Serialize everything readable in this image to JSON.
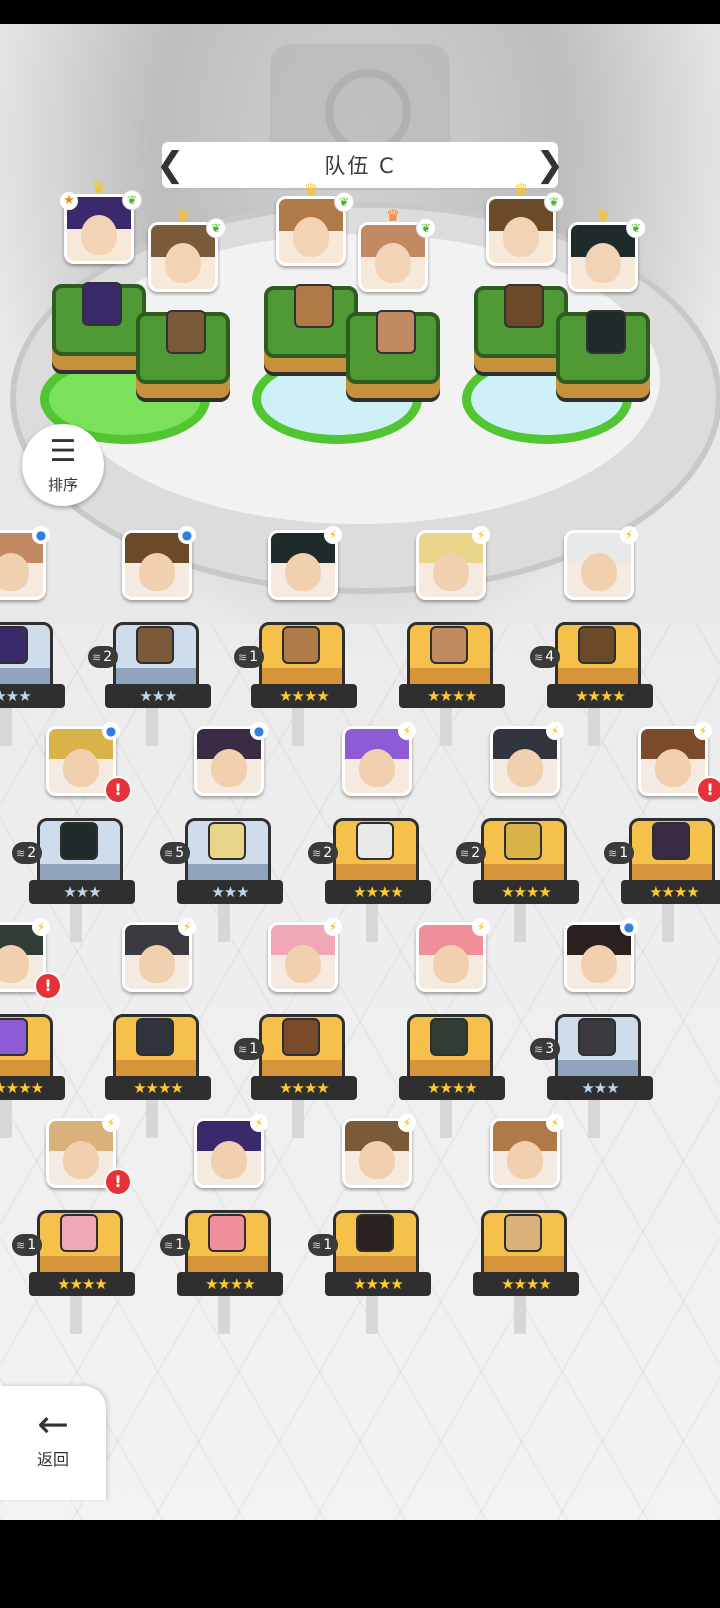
{
  "team": {
    "title": "队伍 C",
    "prev": "❮",
    "next": "❯"
  },
  "sort": {
    "label": "排序",
    "icon": "sort-icon"
  },
  "back": {
    "label": "返回",
    "icon": "back-arrow-icon"
  },
  "team_slots": [
    {
      "leader": "★",
      "type": "earth",
      "crown": "gold"
    },
    {
      "type": "earth",
      "crown": "gold"
    },
    {
      "type": "earth",
      "crown": "gold"
    },
    {
      "type": "earth",
      "crown": "orange"
    },
    {
      "type": "earth",
      "crown": "gold"
    },
    {
      "type": "earth",
      "crown": "gold"
    }
  ],
  "roster": [
    {
      "stars": "★★★",
      "tier": "blue",
      "type": "water",
      "count": ""
    },
    {
      "stars": "★★★",
      "tier": "blue",
      "type": "water",
      "count": "2"
    },
    {
      "stars": "★★★★",
      "tier": "gold",
      "type": "bolt",
      "count": "1"
    },
    {
      "stars": "★★★★",
      "tier": "gold",
      "type": "bolt",
      "count": ""
    },
    {
      "stars": "★★★★",
      "tier": "gold",
      "type": "bolt",
      "count": "4"
    },
    {
      "stars": "★★★",
      "tier": "blue",
      "type": "water",
      "count": "2",
      "alert": "!"
    },
    {
      "stars": "★★★",
      "tier": "blue",
      "type": "water",
      "count": "5"
    },
    {
      "stars": "★★★★",
      "tier": "gold",
      "type": "bolt",
      "count": "2"
    },
    {
      "stars": "★★★★",
      "tier": "gold",
      "type": "bolt",
      "count": "2"
    },
    {
      "stars": "★★★★",
      "tier": "gold",
      "type": "bolt",
      "count": "1",
      "alert": "!"
    },
    {
      "stars": "★★★★★",
      "tier": "gold",
      "type": "bolt",
      "count": "",
      "alert": "!"
    },
    {
      "stars": "★★★★",
      "tier": "gold",
      "type": "bolt",
      "count": ""
    },
    {
      "stars": "★★★★",
      "tier": "gold",
      "type": "bolt",
      "count": "1"
    },
    {
      "stars": "★★★★",
      "tier": "gold",
      "type": "bolt",
      "count": ""
    },
    {
      "stars": "★★★",
      "tier": "blue",
      "type": "water",
      "count": "3"
    },
    {
      "stars": "★★★★",
      "tier": "gold",
      "type": "bolt",
      "count": "1",
      "alert": "!"
    },
    {
      "stars": "★★★★",
      "tier": "gold",
      "type": "bolt",
      "count": "1"
    },
    {
      "stars": "★★★★",
      "tier": "gold",
      "type": "bolt",
      "count": "1"
    },
    {
      "stars": "★★★★",
      "tier": "gold",
      "type": "bolt",
      "count": ""
    }
  ],
  "colors": {
    "accent": "#f6c14a",
    "alert": "#e8323a",
    "water": "#2e7fe0",
    "bolt": "#f3b400"
  }
}
